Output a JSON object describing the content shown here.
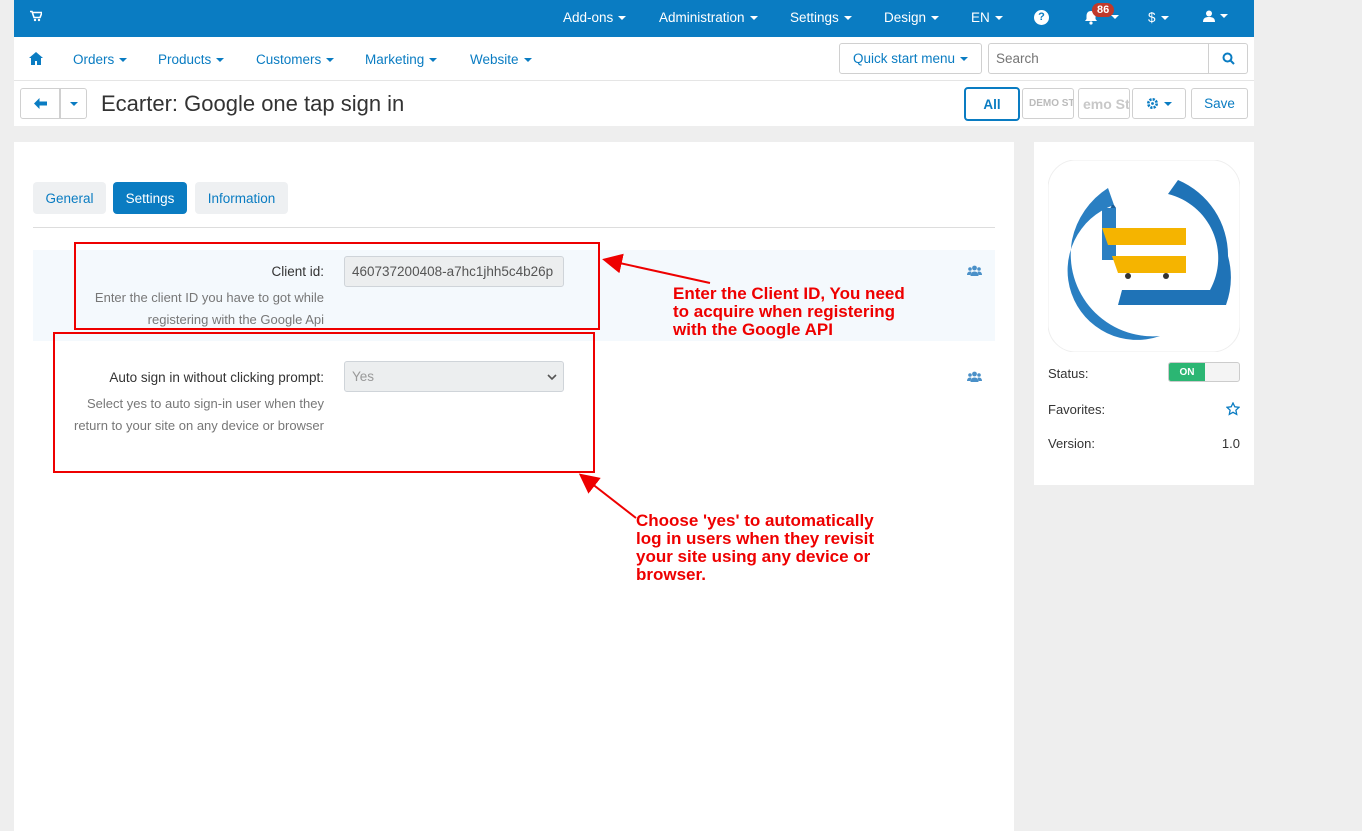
{
  "topbar": {
    "menus": [
      "Add-ons",
      "Administration",
      "Settings",
      "Design",
      "EN"
    ],
    "notification_count": "86",
    "currency": "$",
    "color": "#0a7cc2"
  },
  "nav": {
    "items": [
      "Orders",
      "Products",
      "Customers",
      "Marketing",
      "Website"
    ],
    "quick_start": "Quick start menu",
    "search_placeholder": "Search"
  },
  "titlebar": {
    "title": "Ecarter: Google one tap sign in",
    "all_label": "All",
    "demo1": "DEMO STORE",
    "demo2": "emo Sto",
    "save_label": "Save"
  },
  "tabs": [
    {
      "label": "General",
      "active": false
    },
    {
      "label": "Settings",
      "active": true
    },
    {
      "label": "Information",
      "active": false
    }
  ],
  "settings": {
    "client_id_label": "Client id:",
    "client_id_help": "Enter the client ID you have to got while registering with the Google Api",
    "client_id_value": "460737200408-a7hc1jhh5c4b26p",
    "auto_label": "Auto sign in without clicking prompt:",
    "auto_help": "Select yes to auto sign-in user when they return to your site on any device or browser",
    "auto_value": "Yes"
  },
  "annotations": {
    "client_note": "Enter the Client ID, You need to acquire when registering with the Google API",
    "auto_note": "Choose 'yes' to automatically log in users when they revisit your site using any device or browser."
  },
  "sidebar": {
    "status_label": "Status:",
    "status_value": "ON",
    "favorites_label": "Favorites:",
    "version_label": "Version:",
    "version_value": "1.0"
  }
}
